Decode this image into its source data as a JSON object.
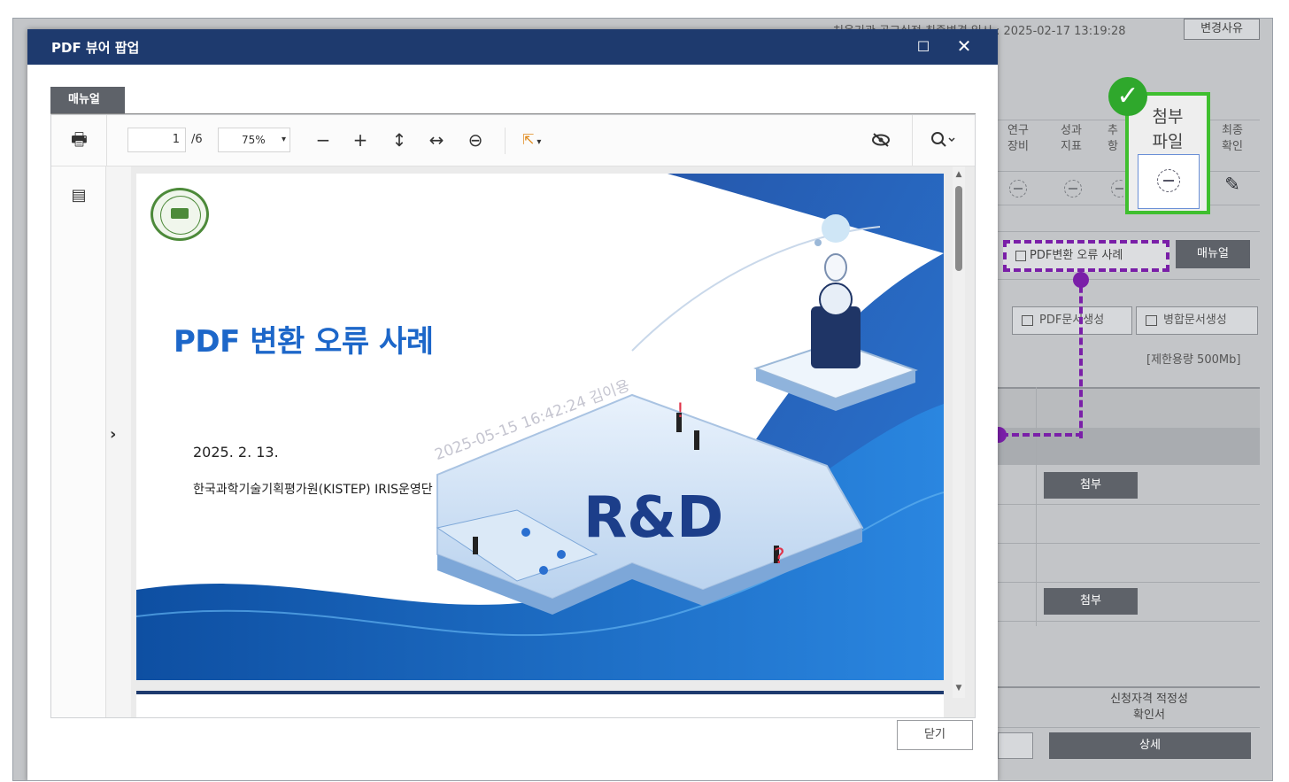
{
  "background": {
    "final_change_timestamp": "처음기관 공고실적 최종변경 일시 : 2025-02-17 13:19:28",
    "change_reason_label": "변경사유",
    "columns": [
      {
        "label_line1": "연구",
        "label_line2": "장비"
      },
      {
        "label_line1": "성과",
        "label_line2": "지표"
      },
      {
        "label_line1": "추",
        "label_line2": "항"
      },
      {
        "label_line1": "최종",
        "label_line2": "확인"
      }
    ],
    "attachment_column": {
      "line1": "첨부",
      "line2": "파일"
    },
    "pdf_error_button": "PDF변환 오류 사례",
    "manual_button": "매뉴얼",
    "pdf_generate_button": "PDF문서생성",
    "merge_generate_button": "병합문서생성",
    "size_limit": "[제한용량 500Mb]",
    "attach_buttons": [
      "첨부",
      "첨부"
    ],
    "eligibility_line1": "신청자격 적정성",
    "eligibility_line2": "확인서",
    "detail_button": "상세"
  },
  "popup": {
    "title": "PDF 뷰어 팝업",
    "tab": "매뉴얼",
    "close_button": "닫기"
  },
  "viewer": {
    "current_page": "1",
    "total_pages": "/6",
    "zoom": "75%"
  },
  "slide": {
    "title": "PDF 변환 오류 사례",
    "date": "2025. 2. 13.",
    "organization": "한국과학기술기획평가원(KISTEP) IRIS운영단",
    "watermark": "2025-05-15 16:42:24 김이용"
  },
  "colors": {
    "popup_header": "#1e3a6e",
    "highlight_green": "#3fbf2f",
    "callout_purple": "#7a1fa8",
    "slide_title_blue": "#1d67c9"
  }
}
